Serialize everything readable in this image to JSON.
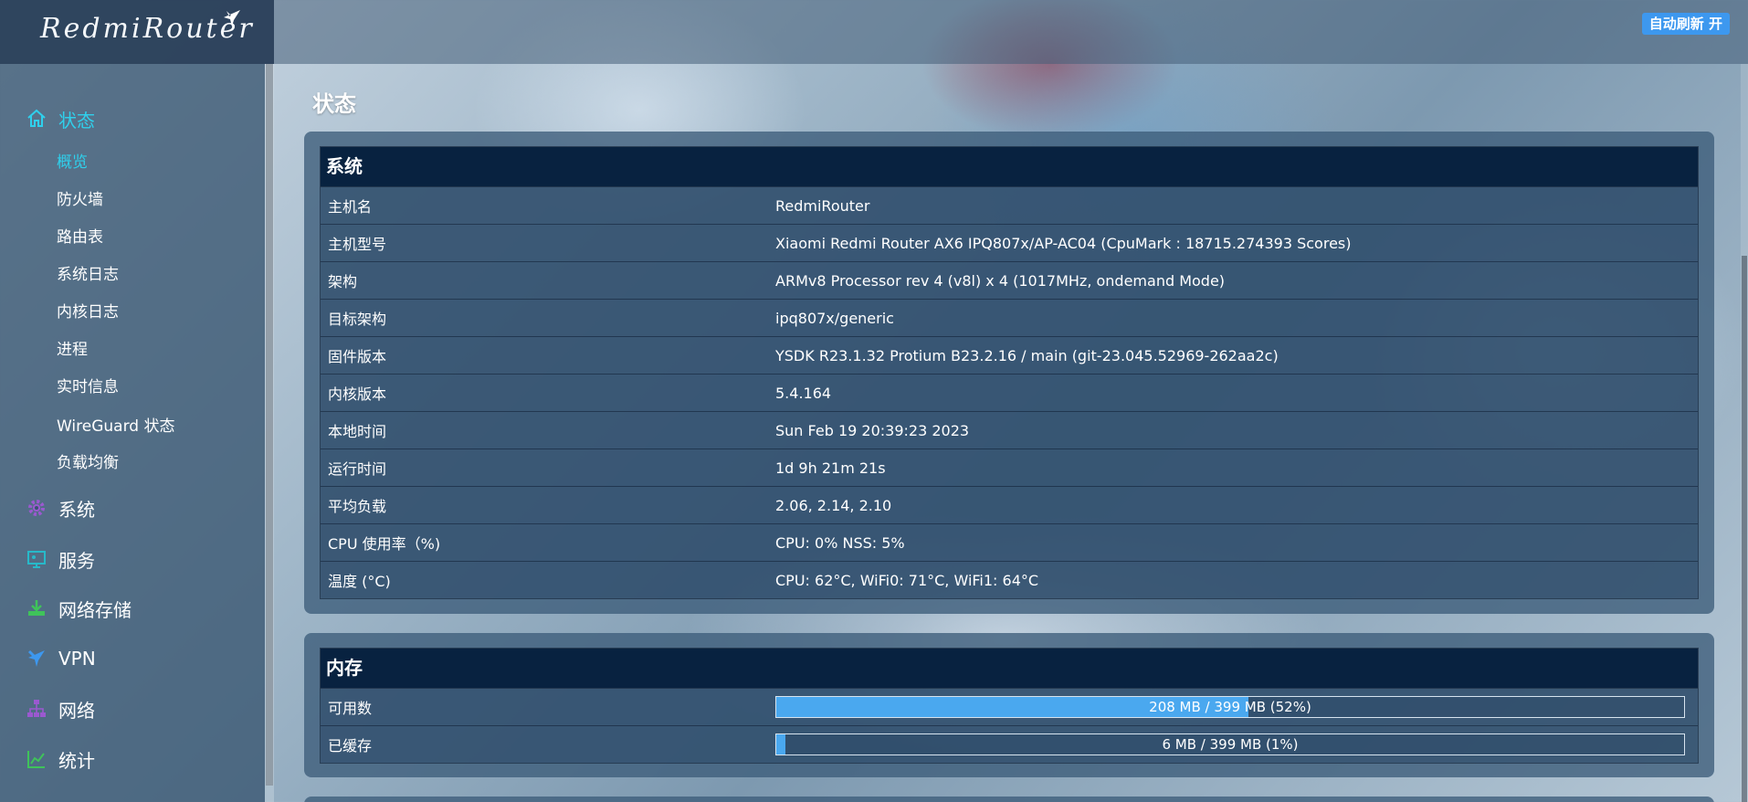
{
  "header": {
    "brand": "RedmiRouter",
    "auto_refresh": "自动刷新 开"
  },
  "sidebar": {
    "status": {
      "label": "状态",
      "items": [
        "概览",
        "防火墙",
        "路由表",
        "系统日志",
        "内核日志",
        "进程",
        "实时信息",
        "WireGuard 状态",
        "负载均衡"
      ]
    },
    "menus": [
      {
        "label": "系统",
        "icon": "gear-icon",
        "color": "#9b59d0"
      },
      {
        "label": "服务",
        "icon": "services-icon",
        "color": "#27b9c9"
      },
      {
        "label": "网络存储",
        "icon": "download-icon",
        "color": "#3fc35a"
      },
      {
        "label": "VPN",
        "icon": "airplane-icon",
        "color": "#3d98ef"
      },
      {
        "label": "网络",
        "icon": "network-icon",
        "color": "#9b59d0"
      },
      {
        "label": "统计",
        "icon": "chart-icon",
        "color": "#3fc35a"
      }
    ]
  },
  "main": {
    "page_title": "状态",
    "system": {
      "title": "系统",
      "rows": [
        {
          "label": "主机名",
          "value": "RedmiRouter"
        },
        {
          "label": "主机型号",
          "value": "Xiaomi Redmi Router AX6 IPQ807x/AP-AC04 (CpuMark : 18715.274393 Scores)"
        },
        {
          "label": "架构",
          "value": "ARMv8 Processor rev 4 (v8l) x 4 (1017MHz, ondemand Mode)"
        },
        {
          "label": "目标架构",
          "value": "ipq807x/generic"
        },
        {
          "label": "固件版本",
          "value": "YSDK R23.1.32 Protium B23.2.16 / main (git-23.045.52969-262aa2c)"
        },
        {
          "label": "内核版本",
          "value": "5.4.164"
        },
        {
          "label": "本地时间",
          "value": "Sun Feb 19 20:39:23 2023"
        },
        {
          "label": "运行时间",
          "value": "1d 9h 21m 21s"
        },
        {
          "label": "平均负载",
          "value": "2.06, 2.14, 2.10"
        },
        {
          "label": "CPU 使用率（%)",
          "value": "CPU: 0% NSS: 5%"
        },
        {
          "label": "温度 (°C)",
          "value": "CPU: 62°C, WiFi0: 71°C, WiFi1: 64°C"
        }
      ]
    },
    "memory": {
      "title": "内存",
      "rows": [
        {
          "label": "可用数",
          "text": "208 MB / 399 MB (52%)",
          "percent": 52
        },
        {
          "label": "已缓存",
          "text": "6 MB / 399 MB (1%)",
          "percent": 1
        }
      ]
    }
  },
  "colors": {
    "accent": "#2fd0ec",
    "bar_fill": "#4aa8ef",
    "header_bg": "#082240"
  }
}
